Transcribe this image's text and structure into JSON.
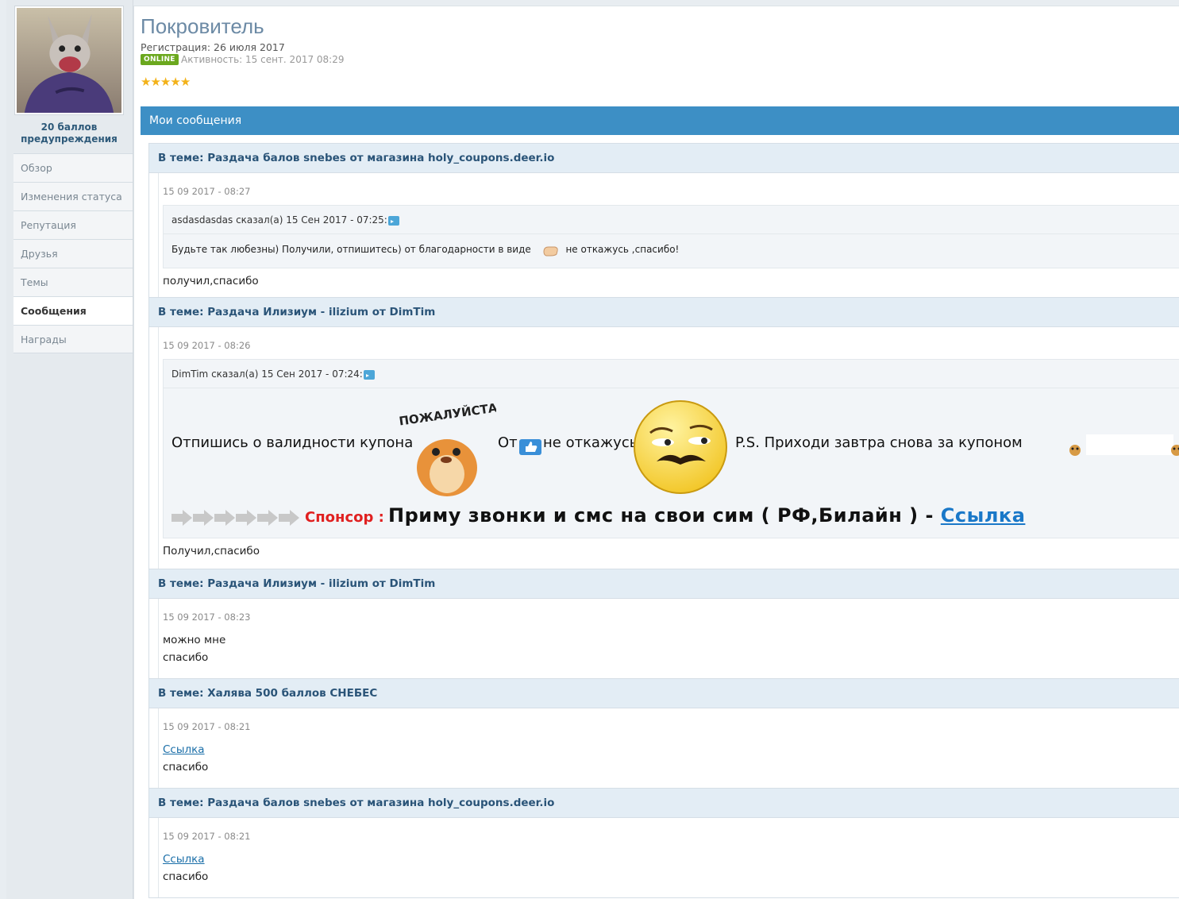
{
  "profile": {
    "warnings": "20 баллов предупреждения",
    "title": "Покровитель",
    "registration": "Регистрация: 26 июля 2017",
    "online_badge": "ONLINE",
    "activity": "Активность: 15 сент. 2017 08:29",
    "rating_stars": 5
  },
  "sidebar": {
    "items": [
      {
        "label": "Обзор"
      },
      {
        "label": "Изменения статуса"
      },
      {
        "label": "Репутация"
      },
      {
        "label": "Друзья"
      },
      {
        "label": "Темы"
      },
      {
        "label": "Сообщения"
      },
      {
        "label": "Награды"
      }
    ],
    "active": "Сообщения"
  },
  "section_title": "Мои сообщения",
  "posts": [
    {
      "topic": "В теме: Раздача балов snebes от магазина holy_coupons.deer.io",
      "date": "15 09 2017 - 08:27",
      "quote_author": "asdasdasdas сказал(а) 15 Сен 2017 - 07:25:",
      "quote_text_a": "Будьте так любезны) Получили, отпишитесь) от благодарности в виде",
      "quote_text_b": "не откажусь ,спасибо!",
      "text": "получил,спасибо"
    },
    {
      "topic": "В теме: Раздача Илизиум - ilizium от DimTim",
      "date": "15 09 2017 - 08:26",
      "quote_author": "DimTim сказал(а) 15 Сен 2017 - 07:24:",
      "quote_text_a": "Отпишись о валидности купона",
      "sticker_text": "ПОЖАЛУЙСТА",
      "quote_text_b": "От",
      "quote_text_c": "не откажусь",
      "quote_text_d": "P.S. Приходи завтра снова за купоном",
      "sponsor_label": "Спонсор :",
      "sponsor_text": "Приму звонки и смс на свои сим ( РФ,Билайн ) -",
      "sponsor_link": "Ссылка",
      "text": "Получил,спасибо"
    },
    {
      "topic": "В теме: Раздача Илизиум - ilizium от DimTim",
      "date": "15 09 2017 - 08:23",
      "line1": "можно мне",
      "line2": "спасибо"
    },
    {
      "topic": "В теме: Халява 500 баллов СНЕБЕС",
      "date": "15 09 2017 - 08:21",
      "link": "Ссылка",
      "line2": "спасибо"
    },
    {
      "topic": "В теме: Раздача балов snebes от магазина holy_coupons.deer.io",
      "date": "15 09 2017 - 08:21",
      "link": "Ссылка",
      "line2": "спасибо"
    }
  ],
  "colors": {
    "header_bar": "#3d8fc5",
    "topic_text": "#2a5478",
    "online": "#6ba81e",
    "sponsor": "#e02020"
  }
}
